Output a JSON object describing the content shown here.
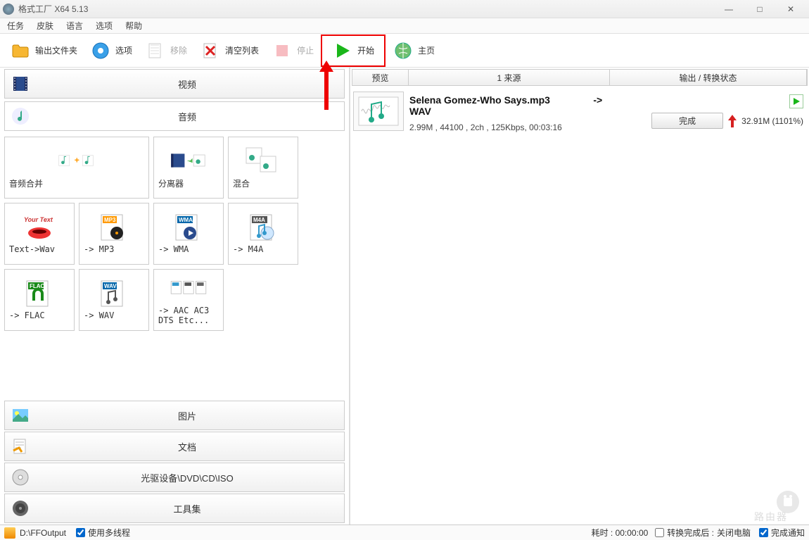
{
  "window": {
    "title": "格式工厂 X64 5.13",
    "min": "—",
    "max": "□",
    "close": "✕"
  },
  "menu": {
    "task": "任务",
    "skin": "皮肤",
    "language": "语言",
    "options": "选项",
    "help": "帮助"
  },
  "toolbar": {
    "output_folder": "输出文件夹",
    "options": "选项",
    "remove": "移除",
    "clearlist": "清空列表",
    "stop": "停止",
    "start": "开始",
    "home": "主页"
  },
  "categories": {
    "video": "视频",
    "audio": "音频",
    "image": "图片",
    "document": "文档",
    "dvd": "光驱设备\\DVD\\CD\\ISO",
    "tools": "工具集"
  },
  "tiles": {
    "audio_merge": "音频合并",
    "splitter": "分离器",
    "mix": "混合",
    "text2wav": "Text->Wav",
    "mp3": "-> MP3",
    "wma": "-> WMA",
    "m4a": "-> M4A",
    "flac": "-> FLAC",
    "wav": "-> WAV",
    "aac": "-> AAC AC3 DTS Etc..."
  },
  "list": {
    "header": {
      "preview": "预览",
      "source": "1 来源",
      "status": "输出 / 转换状态"
    },
    "item": {
      "filename": "Selena Gomez-Who Says.mp3",
      "convert_to": "-> WAV",
      "meta": "2.99M , 44100 , 2ch , 125Kbps, 00:03:16",
      "done": "完成",
      "size": "32.91M  (1101%)"
    }
  },
  "statusbar": {
    "output_path": "D:\\FFOutput",
    "multithread": "使用多线程",
    "elapsed_label": "耗时 :",
    "elapsed": "00:00:00",
    "after_label": "转换完成后 :",
    "after_value": "关闭电脑",
    "notify": "完成通知"
  }
}
